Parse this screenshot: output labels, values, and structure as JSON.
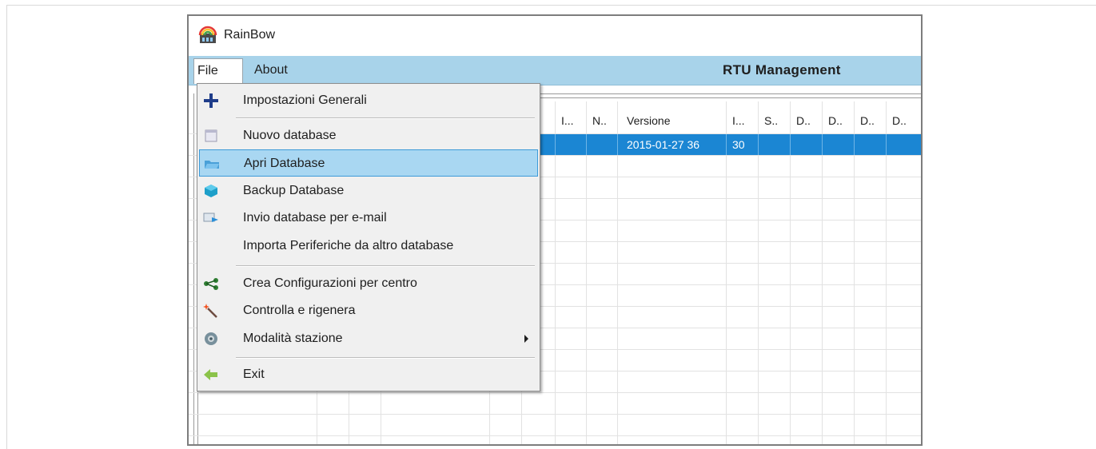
{
  "window": {
    "title": "RainBow"
  },
  "menubar": {
    "file_label": "File",
    "about_label": "About",
    "title": "RTU Management"
  },
  "grid": {
    "headers": [
      "I...",
      "N..",
      "Versione",
      "I...",
      "S..",
      "D..",
      "D..",
      "D..",
      "D.."
    ],
    "selected_row": {
      "versione": "2015-01-27 36",
      "i": "30"
    }
  },
  "file_menu": {
    "items": [
      {
        "label": "Impostazioni Generali",
        "icon": "plus-icon"
      },
      {
        "label": "Nuovo database",
        "icon": "new-database-icon"
      },
      {
        "label": "Apri Database",
        "icon": "folder-open-icon",
        "highlighted": true
      },
      {
        "label": "Backup Database",
        "icon": "backup-icon"
      },
      {
        "label": "Invio database per e-mail",
        "icon": "send-email-icon"
      },
      {
        "label": "Importa Periferiche da altro database",
        "icon": ""
      },
      {
        "label": "Crea Configurazioni per centro",
        "icon": "network-icon"
      },
      {
        "label": "Controlla e rigenera",
        "icon": "magic-wand-icon"
      },
      {
        "label": "Modalità stazione",
        "icon": "station-mode-icon",
        "has_submenu": true
      },
      {
        "label": "Exit",
        "icon": "exit-arrow-icon"
      }
    ]
  },
  "colors": {
    "menubar": "#a8d3ea",
    "selection": "#1b86d3",
    "menu_highlight": "#a9d7f2"
  }
}
